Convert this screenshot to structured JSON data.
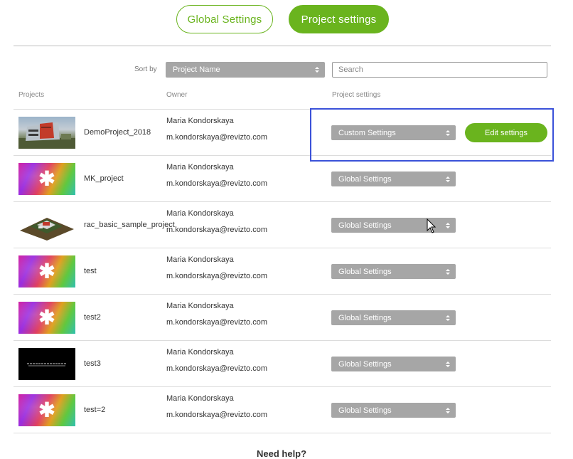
{
  "tabs": {
    "global": "Global Settings",
    "project": "Project settings"
  },
  "toolbar": {
    "sort_label": "Sort by",
    "sort_value": "Project Name",
    "search_placeholder": "Search"
  },
  "columns": {
    "projects": "Projects",
    "owner": "Owner",
    "settings": "Project settings"
  },
  "rows": [
    {
      "name": "DemoProject_2018",
      "thumb": "building-photo",
      "owner": "Maria Kondorskaya",
      "email": "m.kondorskaya@revizto.com",
      "setting": "Custom Settings",
      "edit": "Edit settings"
    },
    {
      "name": "MK_project",
      "thumb": "gradient-logo",
      "owner": "Maria Kondorskaya",
      "email": "m.kondorskaya@revizto.com",
      "setting": "Global Settings"
    },
    {
      "name": "rac_basic_sample_project",
      "thumb": "model-3d",
      "owner": "Maria Kondorskaya",
      "email": "m.kondorskaya@revizto.com",
      "setting": "Global Settings"
    },
    {
      "name": "test",
      "thumb": "gradient-logo",
      "owner": "Maria Kondorskaya",
      "email": "m.kondorskaya@revizto.com",
      "setting": "Global Settings"
    },
    {
      "name": "test2",
      "thumb": "gradient-logo",
      "owner": "Maria Kondorskaya",
      "email": "m.kondorskaya@revizto.com",
      "setting": "Global Settings"
    },
    {
      "name": "test3",
      "thumb": "dark-model",
      "owner": "Maria Kondorskaya",
      "email": "m.kondorskaya@revizto.com",
      "setting": "Global Settings"
    },
    {
      "name": "test=2",
      "thumb": "gradient-logo",
      "owner": "Maria Kondorskaya",
      "email": "m.kondorskaya@revizto.com",
      "setting": "Global Settings"
    }
  ],
  "footer": {
    "help": "Need help?"
  },
  "colors": {
    "accent": "#6ab41e",
    "select_bg": "#a6a6a6",
    "highlight": "#3b52d9"
  }
}
